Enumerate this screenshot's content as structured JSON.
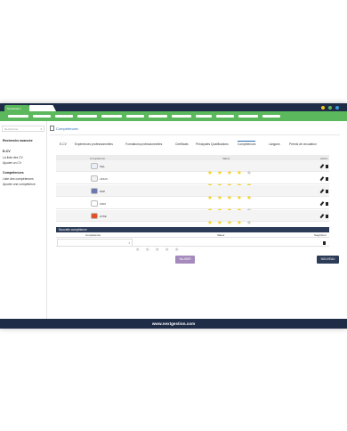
{
  "app": {
    "tab_label": "NextGestion"
  },
  "colors": {
    "navy": "#1e2c48",
    "green": "#5cb85c",
    "star_on": "#f4d21a",
    "star_off": "#c8c8c8"
  },
  "sidebar": {
    "search_placeholder": "Rechercher",
    "advanced_search": "Recherche avancée",
    "section_ecv": "E-CV",
    "ecv_list": "La liste des CV",
    "ecv_add": "Ajouter un CV",
    "section_comp": "Compétences",
    "comp_list": "Liste des compétences",
    "comp_add": "Ajouter une compétence"
  },
  "breadcrumb": "Compétences",
  "tabs": [
    {
      "label": "E-CV"
    },
    {
      "label": "Expériences professionnelles"
    },
    {
      "label": "Formations professionnelles"
    },
    {
      "label": "Certificats"
    },
    {
      "label": "Principales Qualifications"
    },
    {
      "label": "Compétences"
    },
    {
      "label": "Langues"
    },
    {
      "label": "Permis de circulation"
    }
  ],
  "table": {
    "headers": {
      "competence": "Compétence",
      "value": "Valeur",
      "action": "Action"
    },
    "rows": [
      {
        "label": "SQL",
        "icon": "sql-logo",
        "rating": 4
      },
      {
        "label": "LINUX",
        "icon": "linux-logo",
        "rating": 5
      },
      {
        "label": "PHP",
        "icon": "php-logo",
        "rating": 5
      },
      {
        "label": "UNIX",
        "icon": "unix-logo",
        "rating": 4
      },
      {
        "label": "HTML",
        "icon": "html5-logo",
        "rating": 4
      }
    ]
  },
  "new_competence": {
    "title": "Nouvelle compétence",
    "col_competence": "Compétence",
    "col_value": "Valeur",
    "col_delete": "Supprimer"
  },
  "buttons": {
    "validate": "VALIDER",
    "new": "NOUVEAU"
  },
  "footer": "www.nextgestion.com"
}
